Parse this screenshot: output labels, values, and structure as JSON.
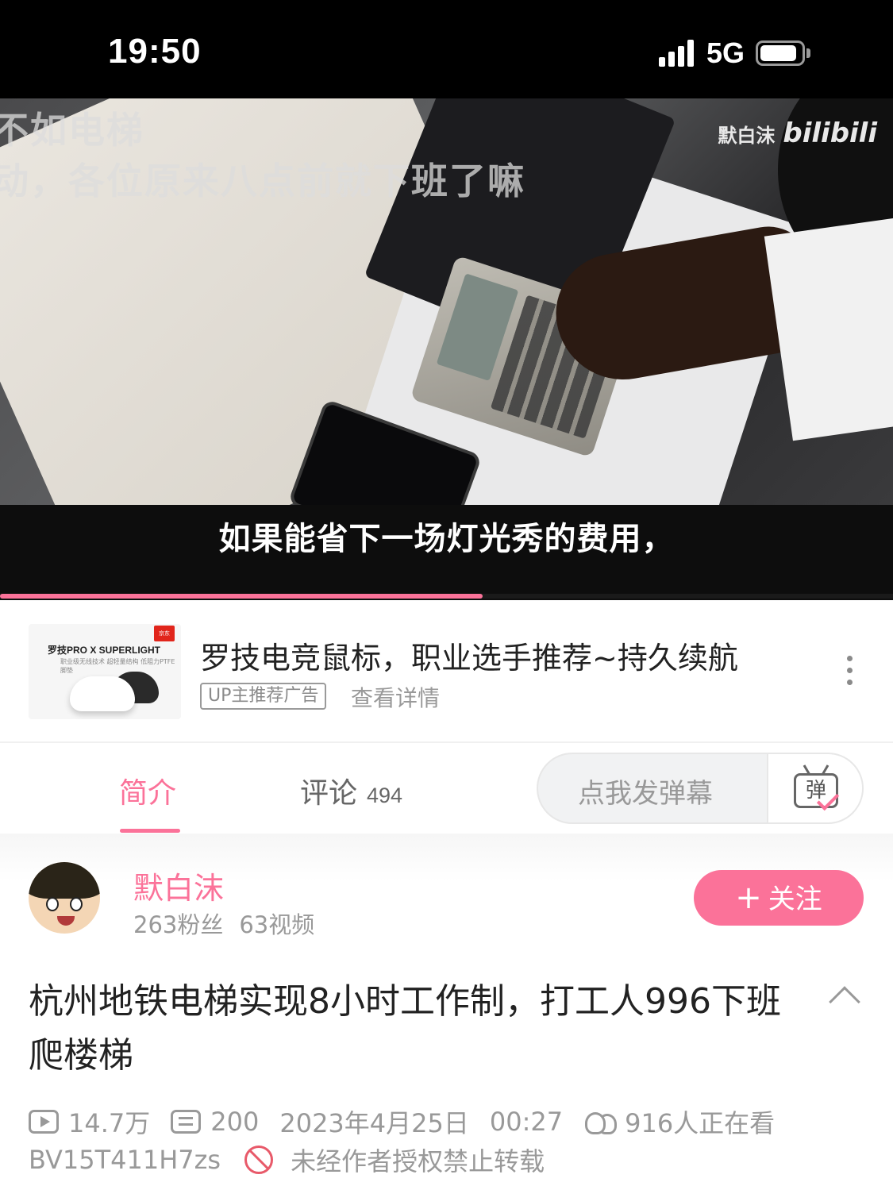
{
  "status_bar": {
    "time": "19:50",
    "network": "5G",
    "signal_bars": 4,
    "battery_level": 0.9
  },
  "video": {
    "overlay_line1": "不如电梯",
    "overlay_line2": "动，各位原来八点前就下班了嘛",
    "watermark_author": "默白沫",
    "watermark_brand": "bilibili",
    "subtitle": "如果能省下一场灯光秀的费用，",
    "progress": 0.54
  },
  "ad": {
    "thumb_brand": "罗技PRO X SUPERLIGHT",
    "thumb_sub": "职业级无线技术 超轻量结构 低阻力PTFE脚垫",
    "thumb_logo": "京东",
    "title": "罗技电竞鼠标，职业选手推荐~持久续航",
    "tag": "UP主推荐广告",
    "detail": "查看详情"
  },
  "tabs": {
    "intro": "简介",
    "comments": "评论",
    "comments_count": "494",
    "danmaku_placeholder": "点我发弹幕",
    "danmaku_icon_char": "弹"
  },
  "uploader": {
    "name": "默白沫",
    "fans": "263粉丝",
    "videos": "63视频",
    "follow_label": "关注"
  },
  "video_info": {
    "title": "杭州地铁电梯实现8小时工作制，打工人996下班爬楼梯",
    "views": "14.7万",
    "danmaku": "200",
    "date": "2023年4月25日",
    "time": "00:27",
    "watching": "916人正在看",
    "bvid": "BV15T411H7zs",
    "copyright": "未经作者授权禁止转载"
  },
  "colors": {
    "accent": "#fb7299",
    "warning": "#e85a6a"
  }
}
